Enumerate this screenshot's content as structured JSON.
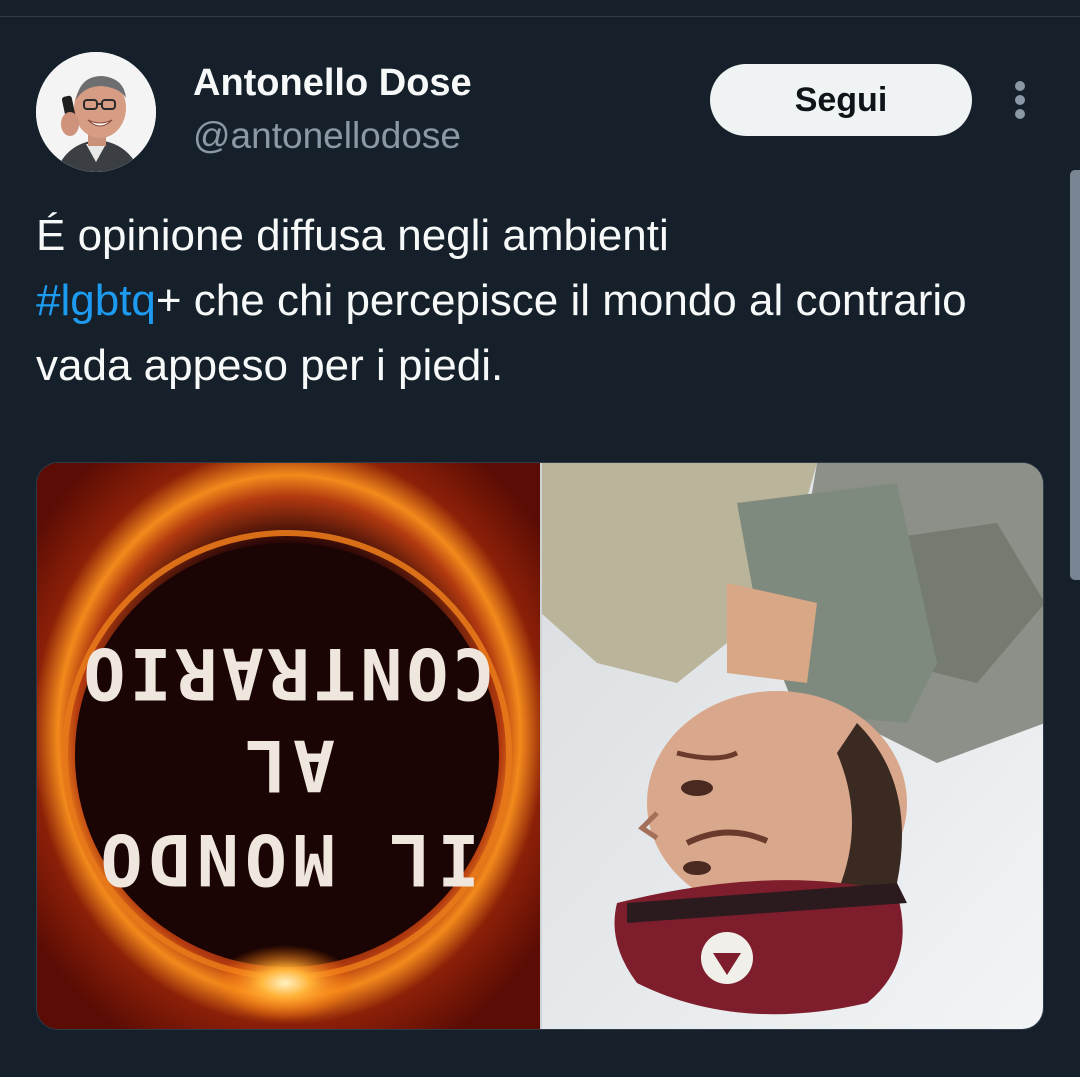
{
  "author": {
    "display_name": "Antonello Dose",
    "handle": "@antonellodose"
  },
  "follow_button": {
    "label": "Segui"
  },
  "tweet": {
    "text_part1": "É opinione diffusa negli ambienti",
    "hashtag": "#lgbtq",
    "text_part2": "+ che chi percepisce il mondo al contrario vada appeso per i piedi."
  },
  "media": {
    "book_cover_text": [
      "IL MONDO",
      "AL",
      "CONTRARIO"
    ]
  },
  "colors": {
    "background": "#15202b",
    "text_primary": "#f7f9f9",
    "text_secondary": "#8b98a5",
    "link": "#1d9bf0",
    "button_bg": "#eff3f4"
  },
  "icons": {
    "more": "vertical-ellipsis-icon"
  }
}
